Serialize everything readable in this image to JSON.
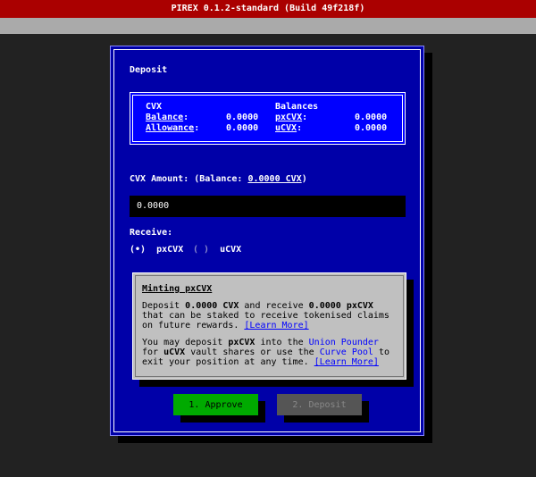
{
  "app": {
    "title": "PIREX 0.1.2-standard (Build 49f218f)"
  },
  "deposit": {
    "title": "Deposit",
    "cvx": {
      "heading": "CVX",
      "balance_label": "Balance",
      "balance_value": "0.0000",
      "allowance_label": "Allowance",
      "allowance_value": "0.0000"
    },
    "balances": {
      "heading": "Balances",
      "pxcvx_label": "pxCVX",
      "pxcvx_value": "0.0000",
      "ucvx_label": "uCVX",
      "ucvx_value": "0.0000"
    },
    "amount": {
      "label_prefix": "CVX Amount: (Balance:",
      "label_balance": "0.0000 CVX",
      "label_suffix": ")",
      "value": "0.0000"
    },
    "receive": {
      "label": "Receive:",
      "options": [
        {
          "marker": "(•)",
          "label": "pxCVX"
        },
        {
          "marker": "( )",
          "label": "uCVX"
        }
      ]
    },
    "info": {
      "title": "Minting pxCVX",
      "p1_a": "Deposit ",
      "p1_b": "0.0000 CVX",
      "p1_c": " and receive ",
      "p1_d": "0.0000 pxCVX",
      "p1_e": " that can be staked to receive tokenised claims on future rewards. ",
      "p1_link": "[Learn More]",
      "p2_a": "You may deposit ",
      "p2_b": "pxCVX",
      "p2_c": " into the ",
      "p2_link1": "Union Pounder",
      "p2_d": " for ",
      "p2_e": "uCVX",
      "p2_f": " vault shares or use the ",
      "p2_link2": "Curve Pool",
      "p2_g": " to exit your position at any time. ",
      "p2_link3": "[Learn More]"
    },
    "buttons": {
      "approve": "1. Approve",
      "deposit": "2. Deposit"
    }
  }
}
